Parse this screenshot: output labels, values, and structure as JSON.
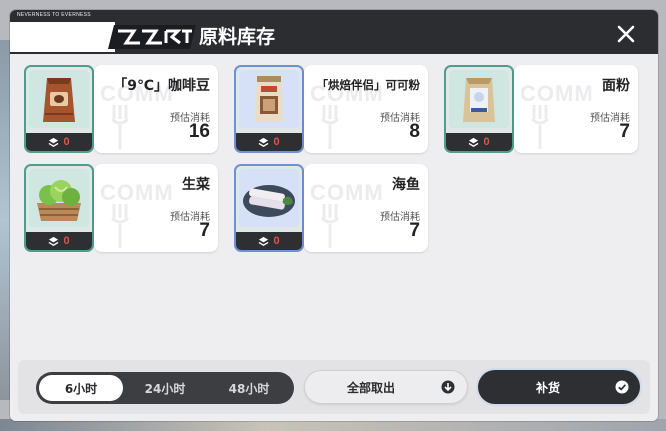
{
  "window": {
    "brand_tag": "NEVERNESS TO EVERNESS",
    "title": "原料库存",
    "close_icon": "close-icon"
  },
  "items": [
    {
      "name": "「9℃」咖啡豆",
      "stock": "0",
      "estimate_label": "预估消耗",
      "estimate_value": "16",
      "rarity_color": "#4d9e8a",
      "icon": "coffee-bean-bag-icon"
    },
    {
      "name": "「烘焙伴侣」可可粉",
      "stock": "0",
      "estimate_label": "预估消耗",
      "estimate_value": "8",
      "rarity_color": "#6f8fd6",
      "icon": "cocoa-powder-icon"
    },
    {
      "name": "面粉",
      "stock": "0",
      "estimate_label": "预估消耗",
      "estimate_value": "7",
      "rarity_color": "#4d9e8a",
      "icon": "flour-bag-icon"
    },
    {
      "name": "生菜",
      "stock": "0",
      "estimate_label": "预估消耗",
      "estimate_value": "7",
      "rarity_color": "#4d9e8a",
      "icon": "lettuce-crate-icon"
    },
    {
      "name": "海鱼",
      "stock": "0",
      "estimate_label": "预估消耗",
      "estimate_value": "7",
      "rarity_color": "#6f8fd6",
      "icon": "sea-fish-icon"
    }
  ],
  "card_watermark": "COMM",
  "time_tabs": [
    {
      "label": "6小时",
      "active": true
    },
    {
      "label": "24小时",
      "active": false
    },
    {
      "label": "48小时",
      "active": false
    }
  ],
  "actions": {
    "take_all_label": "全部取出",
    "restock_label": "补货"
  }
}
